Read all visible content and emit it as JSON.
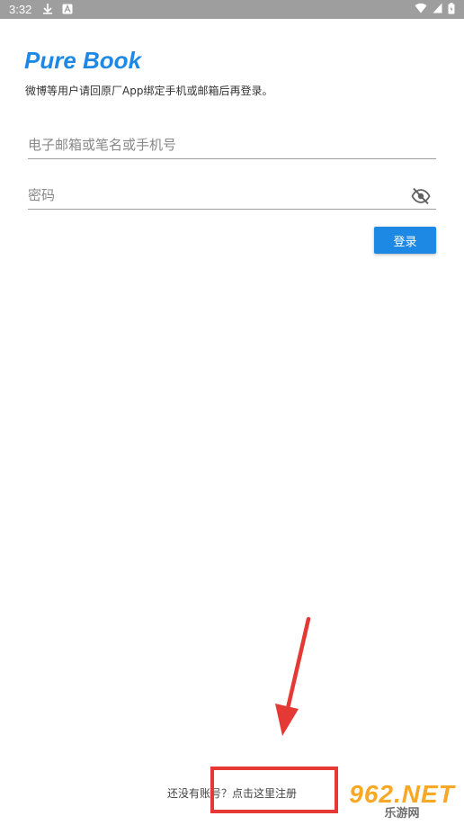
{
  "status_bar": {
    "time": "3:32",
    "left_icons": [
      "download-icon",
      "notification-a-icon"
    ],
    "right_icons": [
      "wifi-icon",
      "signal-icon",
      "battery-icon"
    ]
  },
  "app": {
    "title": "Pure Book",
    "subtitle": "微博等用户请回原厂App绑定手机或邮箱后再登录。"
  },
  "form": {
    "email_placeholder": "电子邮箱或笔名或手机号",
    "email_value": "",
    "password_placeholder": "密码",
    "password_value": "",
    "login_label": "登录"
  },
  "footer": {
    "register_prompt": "还没有账号？",
    "register_link": "点击这里注册"
  },
  "watermark": {
    "brand": "962.NET",
    "sub": "乐游网"
  },
  "colors": {
    "accent": "#1e88e5",
    "status_bar": "#9e9e9e",
    "annotation": "#e53935"
  }
}
